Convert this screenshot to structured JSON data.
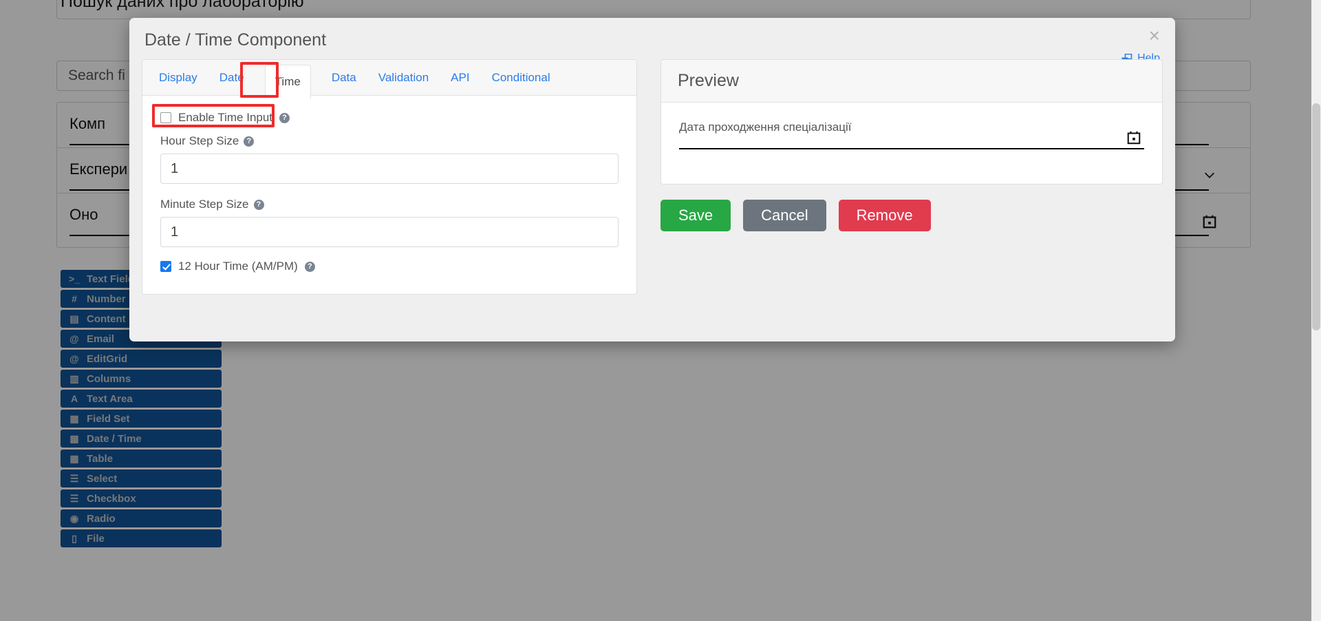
{
  "background": {
    "page_title": "Пошук даних про лабораторію",
    "search_placeholder": "Search fi",
    "fields": [
      {
        "label": "Комп",
        "control": "none"
      },
      {
        "label": "Експери",
        "control": "chevron-down"
      },
      {
        "label": "Оно",
        "control": "calendar"
      }
    ],
    "palette": [
      {
        "label": "Text Field",
        "icon": ">_"
      },
      {
        "label": "Number",
        "icon": "#"
      },
      {
        "label": "Content",
        "icon": "▤"
      },
      {
        "label": "Email",
        "icon": "@"
      },
      {
        "label": "EditGrid",
        "icon": "@"
      },
      {
        "label": "Columns",
        "icon": "▥"
      },
      {
        "label": "Text Area",
        "icon": "A"
      },
      {
        "label": "Field Set",
        "icon": "▦"
      },
      {
        "label": "Date / Time",
        "icon": "▩"
      },
      {
        "label": "Table",
        "icon": "▦"
      },
      {
        "label": "Select",
        "icon": "☰"
      },
      {
        "label": "Checkbox",
        "icon": "☰"
      },
      {
        "label": "Radio",
        "icon": "◉"
      },
      {
        "label": "File",
        "icon": "▯"
      }
    ]
  },
  "modal": {
    "title": "Date / Time Component",
    "close_label": "×",
    "help_label": "Help",
    "tabs": [
      {
        "label": "Display",
        "active": false
      },
      {
        "label": "Date",
        "active": false
      },
      {
        "label": "Time",
        "active": true
      },
      {
        "label": "Data",
        "active": false
      },
      {
        "label": "Validation",
        "active": false
      },
      {
        "label": "API",
        "active": false
      },
      {
        "label": "Conditional",
        "active": false
      }
    ],
    "time_tab": {
      "enable_time_input": {
        "label": "Enable Time Input",
        "checked": false,
        "help": "?"
      },
      "hour_step": {
        "label": "Hour Step Size",
        "value": "1",
        "help": "?"
      },
      "minute_step": {
        "label": "Minute Step Size",
        "value": "1",
        "help": "?"
      },
      "twelve_hour": {
        "label": "12 Hour Time (AM/PM)",
        "checked": true,
        "help": "?"
      }
    },
    "preview": {
      "heading": "Preview",
      "field_label": "Дата проходження спеціалізації"
    },
    "buttons": {
      "save": "Save",
      "cancel": "Cancel",
      "remove": "Remove"
    }
  },
  "colors": {
    "save": "#28a745",
    "cancel": "#6c757d",
    "remove": "#e13b4e",
    "link": "#2b7de9",
    "highlight": "#ef2b2b",
    "palette": "#10559a"
  }
}
